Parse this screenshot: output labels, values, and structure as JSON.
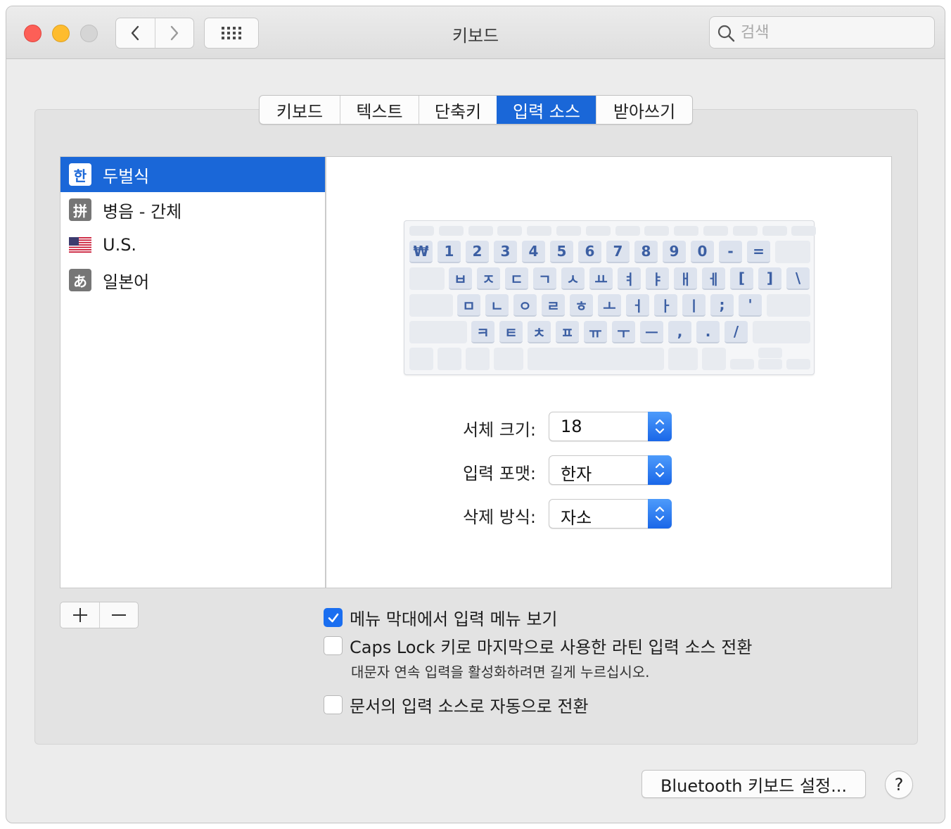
{
  "window": {
    "title": "키보드"
  },
  "search": {
    "placeholder": "검색"
  },
  "tabs": [
    {
      "label": "키보드",
      "active": false
    },
    {
      "label": "텍스트",
      "active": false
    },
    {
      "label": "단축키",
      "active": false
    },
    {
      "label": "입력 소스",
      "active": true
    },
    {
      "label": "받아쓰기",
      "active": false
    }
  ],
  "sources": [
    {
      "icon_text": "한",
      "label": "두벌식",
      "selected": true
    },
    {
      "icon_text": "拼",
      "label": "병음 - 간체",
      "selected": false
    },
    {
      "icon": "us-flag-icon",
      "label": "U.S.",
      "selected": false
    },
    {
      "icon_text": "あ",
      "label": "일본어",
      "selected": false
    }
  ],
  "keyboard": {
    "row1": [
      "₩",
      "1",
      "2",
      "3",
      "4",
      "5",
      "6",
      "7",
      "8",
      "9",
      "0",
      "-",
      "="
    ],
    "row2": [
      "ㅂ",
      "ㅈ",
      "ㄷ",
      "ㄱ",
      "ㅅ",
      "ㅛ",
      "ㅕ",
      "ㅑ",
      "ㅐ",
      "ㅔ",
      "[",
      "]",
      "\\"
    ],
    "row3": [
      "ㅁ",
      "ㄴ",
      "ㅇ",
      "ㄹ",
      "ㅎ",
      "ㅗ",
      "ㅓ",
      "ㅏ",
      "ㅣ",
      ";",
      "'"
    ],
    "row4": [
      "ㅋ",
      "ㅌ",
      "ㅊ",
      "ㅍ",
      "ㅠ",
      "ㅜ",
      "ㅡ",
      ",",
      ".",
      "/"
    ]
  },
  "settings": {
    "font_size": {
      "label": "서체 크기:",
      "value": "18"
    },
    "input_format": {
      "label": "입력 포맷:",
      "value": "한자"
    },
    "delete_mode": {
      "label": "삭제 방식:",
      "value": "자소"
    }
  },
  "options": {
    "show_menu": {
      "label": "메뉴 막대에서 입력 메뉴 보기",
      "checked": true
    },
    "caps_lock": {
      "label": "Caps Lock 키로 마지막으로 사용한 라틴 입력 소스 전환",
      "checked": false
    },
    "caps_hint": "대문자 연속 입력을 활성화하려면 길게 누르십시오.",
    "auto_switch": {
      "label": "문서의 입력 소스로 자동으로 전환",
      "checked": false
    }
  },
  "buttons": {
    "bluetooth": "Bluetooth 키보드 설정...",
    "help": "?"
  },
  "colors": {
    "accent": "#1a67d8",
    "close": "#fd5f57",
    "minimize": "#febc2e"
  }
}
